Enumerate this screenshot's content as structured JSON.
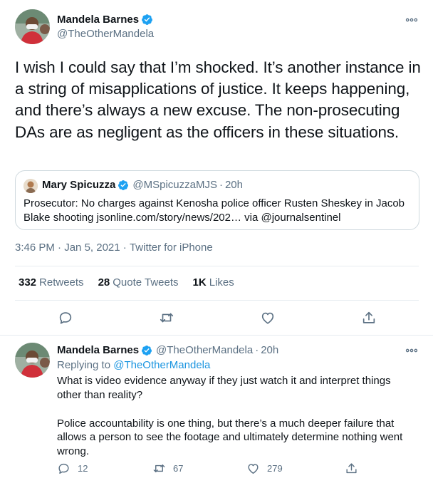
{
  "main_tweet": {
    "author_name": "Mandela Barnes",
    "author_handle": "@TheOtherMandela",
    "text": "I wish I could say that I’m shocked. It’s another instance in a string of misapplications of justice. It keeps happening, and there’s always a new excuse. The non-prosecuting DAs are as negligent as the officers in these situations.",
    "quote": {
      "author_name": "Mary Spicuzza",
      "author_handle": "@MSpicuzzaMJS",
      "separator": "·",
      "time": "20h",
      "text": "Prosecutor: No charges against Kenosha police officer Rusten Sheskey in Jacob Blake shooting jsonline.com/story/news/202… via @journalsentinel"
    },
    "time": "3:46 PM",
    "separator": " · ",
    "date": "Jan 5, 2021",
    "source": "Twitter for iPhone",
    "stats": {
      "retweets_count": "332",
      "retweets_label": "Retweets",
      "quotes_count": "28",
      "quotes_label": "Quote Tweets",
      "likes_count": "1K",
      "likes_label": "Likes"
    },
    "icons": [
      "more-icon",
      "reply-icon",
      "retweet-icon",
      "like-icon",
      "share-icon",
      "verified-icon"
    ]
  },
  "reply_tweet": {
    "author_name": "Mandela Barnes",
    "author_handle": "@TheOtherMandela",
    "separator": "·",
    "time": "20h",
    "replying_to_label": "Replying to ",
    "replying_to_handle": "@TheOtherMandela",
    "paragraph_1": "What is video evidence anyway if they just watch it and interpret things other than reality?",
    "paragraph_2": "Police accountability is one thing, but there’s a much deeper failure that allows a person to see the footage and ultimately determine nothing went wrong.",
    "reply_count": "12",
    "retweet_count": "67",
    "like_count": "279"
  },
  "colors": {
    "text": "#0f1419",
    "secondary": "#5b7083",
    "link": "#1b95e0",
    "verified": "#1da1f2",
    "border": "#e6ecf0"
  }
}
